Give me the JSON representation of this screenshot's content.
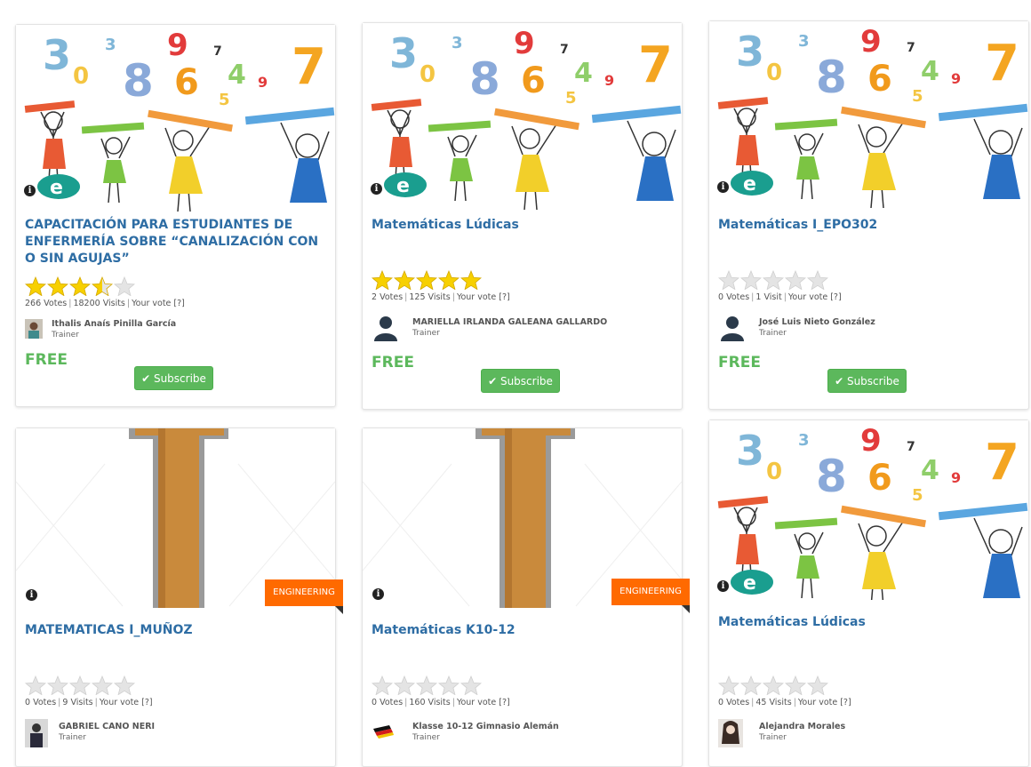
{
  "colors": {
    "title": "#2e6da4",
    "free": "#5cb85c",
    "subscribe_btn": "#5cb85c",
    "category_tag": "#ff6a00",
    "star_filled": "#f7d000",
    "star_empty": "#e4e4e4"
  },
  "cards": [
    {
      "title": "CAPACITACIÓN PARA ESTUDIANTES DE ENFERMERÍA SOBRE “CANALIZACIÓN CON O SIN AGUJAS”",
      "image": "math-kids-pencils",
      "rating": 3.5,
      "votes": "266 Votes",
      "visits": "18200 Visits",
      "your_vote": "Your vote [?]",
      "trainer_name": "Ithalis Anaís Pinilla García",
      "trainer_role": "Trainer",
      "price": "FREE",
      "subscribe": "Subscribe"
    },
    {
      "title": "Matemáticas Lúdicas",
      "image": "math-kids-pencils",
      "rating": 5,
      "votes": "2 Votes",
      "visits": "125 Visits",
      "your_vote": "Your vote [?]",
      "trainer_name": "MARIELLA IRLANDA GALEANA GALLARDO",
      "trainer_role": "Trainer",
      "price": "FREE",
      "subscribe": "Subscribe"
    },
    {
      "title": "Matemáticas I_EPO302",
      "image": "math-kids-pencils",
      "rating": 0,
      "votes": "0 Votes",
      "visits": "1 Visit",
      "your_vote": "Your vote [?]",
      "trainer_name": "José Luis Nieto González",
      "trainer_role": "Trainer",
      "price": "FREE",
      "subscribe": "Subscribe"
    },
    {
      "title": "MATEMATICAS I_MUÑOZ",
      "image": "leather-letter-i",
      "category": "ENGINEERING",
      "rating": 0,
      "votes": "0 Votes",
      "visits": "9 Visits",
      "your_vote": "Your vote [?]",
      "trainer_name": "GABRIEL CANO NERI",
      "trainer_role": "Trainer"
    },
    {
      "title": "Matemáticas K10-12",
      "image": "leather-letter-i",
      "category": "ENGINEERING",
      "rating": 0,
      "votes": "0 Votes",
      "visits": "160 Visits",
      "your_vote": "Your vote [?]",
      "trainer_name": "Klasse 10-12 Gimnasio Alemán",
      "trainer_role": "Trainer"
    },
    {
      "title": "Matemáticas Lúdicas",
      "image": "math-kids-pencils",
      "rating": 0,
      "votes": "0 Votes",
      "visits": "45 Visits",
      "your_vote": "Your vote [?]",
      "trainer_name": "Alejandra Morales",
      "trainer_role": "Trainer"
    }
  ]
}
